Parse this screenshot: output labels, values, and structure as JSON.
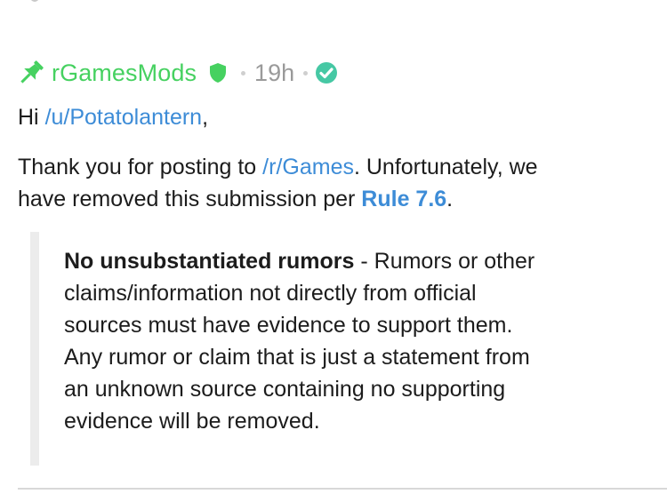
{
  "comment": {
    "author": "rGamesMods",
    "timestamp": "19h",
    "icons": {
      "pin": "pin-icon",
      "shield": "moderator-shield-icon",
      "check": "distinguished-check-icon"
    },
    "colors": {
      "author": "#46d160",
      "link": "#3d8cd7",
      "timestamp": "#9a9a9a",
      "check": "#46c8a4"
    },
    "greeting": {
      "prefix": "Hi ",
      "user_link": "/u/Potatolantern",
      "suffix": ","
    },
    "body": {
      "text_1": "Thank you for posting to ",
      "subreddit_link": "/r/Games",
      "text_2": ". Unfortunately, we",
      "text_3": "have removed this submission per ",
      "rule_link": "Rule 7.6",
      "text_4": "."
    },
    "quote": {
      "rule_title": "No unsubstantiated rumors",
      "line_1_rest": " - Rumors or other",
      "line_2": "claims/information not directly from official",
      "line_3": "sources must have evidence to support them.",
      "line_4": "Any rumor or claim that is just a statement from",
      "line_5": "an unknown source containing no supporting",
      "line_6": "evidence will be removed."
    }
  }
}
